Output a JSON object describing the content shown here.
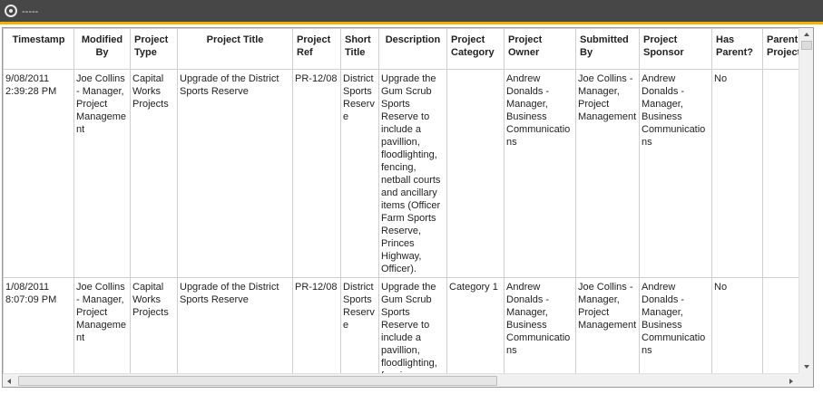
{
  "window": {
    "title": "-----"
  },
  "table": {
    "headers": [
      "Timestamp",
      "Modified By",
      "Project Type",
      "Project Title",
      "Project Ref",
      "Short Title",
      "Description",
      "Project Category",
      "Project Owner",
      "Submitted By",
      "Project Sponsor",
      "Has Parent?",
      "Parent Project"
    ],
    "rows": [
      [
        "9/08/2011 2:39:28 PM",
        "Joe Collins - Manager, Project Management",
        "Capital Works Projects",
        "Upgrade of the District Sports Reserve",
        "PR-12/08",
        "District Sports Reserve",
        "Upgrade the Gum Scrub Sports Reserve to include a pavillion, floodlighting, fencing, netball courts and ancillary items (Officer Farm Sports Reserve, Princes Highway, Officer).",
        "",
        "Andrew Donalds - Manager, Business Communications",
        "Joe Collins - Manager, Project Management",
        "Andrew Donalds - Manager, Business Communications",
        "No",
        ""
      ],
      [
        "1/08/2011 8:07:09 PM",
        "Joe Collins - Manager, Project Management",
        "Capital Works Projects",
        "Upgrade of the District Sports Reserve",
        "PR-12/08",
        "District Sports Reserve",
        "Upgrade the Gum Scrub Sports Reserve to include a pavillion, floodlighting, fencing, netball",
        "Category 1",
        "Andrew Donalds - Manager, Business Communications",
        "Joe Collins - Manager, Project Management",
        "Andrew Donalds - Manager, Business Communications",
        "No",
        ""
      ]
    ]
  }
}
